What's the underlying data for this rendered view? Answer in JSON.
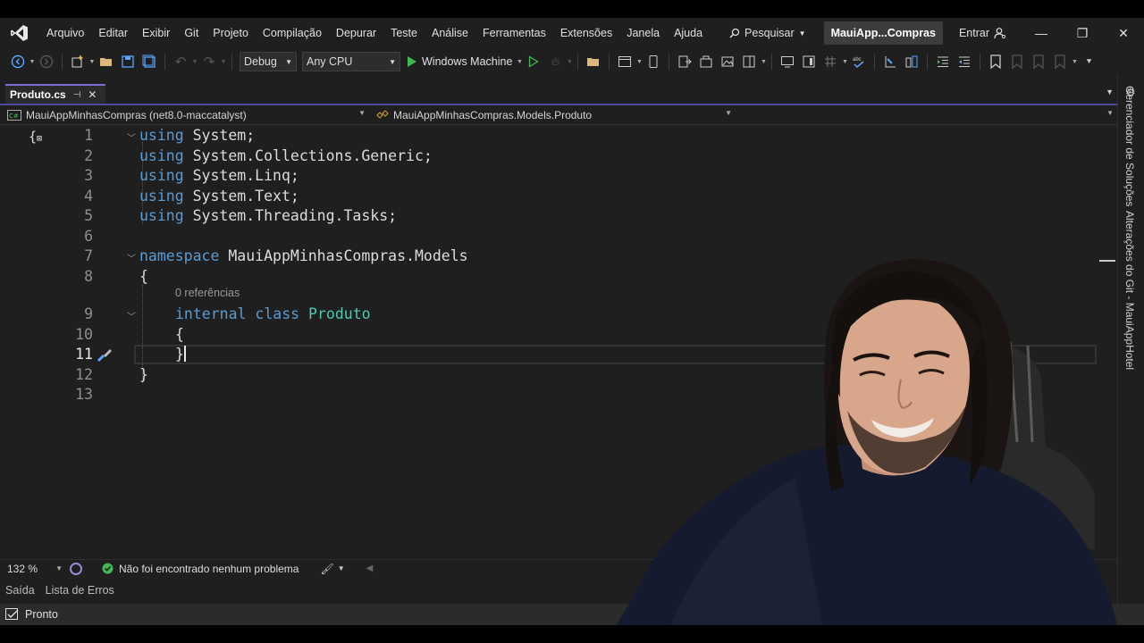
{
  "menu": {
    "items": [
      "Arquivo",
      "Editar",
      "Exibir",
      "Git",
      "Projeto",
      "Compilação",
      "Depurar",
      "Teste",
      "Análise",
      "Ferramentas",
      "Extensões",
      "Janela",
      "Ajuda"
    ],
    "search_label": "Pesquisar",
    "solution_title": "MauiApp...Compras",
    "signin_label": "Entrar"
  },
  "toolbar": {
    "configuration": "Debug",
    "platform": "Any CPU",
    "run_target": "Windows Machine"
  },
  "tabs": [
    {
      "label": "Produto.cs",
      "active": true
    }
  ],
  "navbar": {
    "project": "MauiAppMinhasCompras (net8.0-maccatalyst)",
    "type": "MauiAppMinhasCompras.Models.Produto"
  },
  "editor": {
    "line_numbers": [
      "1",
      "2",
      "3",
      "4",
      "5",
      "6",
      "7",
      "8",
      "9",
      "10",
      "11",
      "12",
      "13"
    ],
    "current_line": 11,
    "usings": [
      "System",
      "System.Collections.Generic",
      "System.Linq",
      "System.Text",
      "System.Threading.Tasks"
    ],
    "kw_using": "using",
    "kw_namespace": "namespace",
    "namespace_name": "MauiAppMinhasCompras.Models",
    "kw_internal": "internal",
    "kw_class": "class",
    "class_name": "Produto",
    "codelens": "0 referências",
    "open_brace": "{",
    "close_brace": "}"
  },
  "editor_status": {
    "zoom": "132 %",
    "issues": "Não foi encontrado nenhum problema"
  },
  "tool_tabs": [
    "Saída",
    "Lista de Erros"
  ],
  "statusbar": {
    "state": "Pronto"
  },
  "side_panel": {
    "solution_explorer": "Gerenciador de Soluções",
    "git_changes": "Alterações do Git - MauiAppHotel"
  },
  "colors": {
    "accent": "#7b6fd6",
    "keyword": "#569cd6",
    "type": "#4ec9b0",
    "success": "#3fb950"
  }
}
